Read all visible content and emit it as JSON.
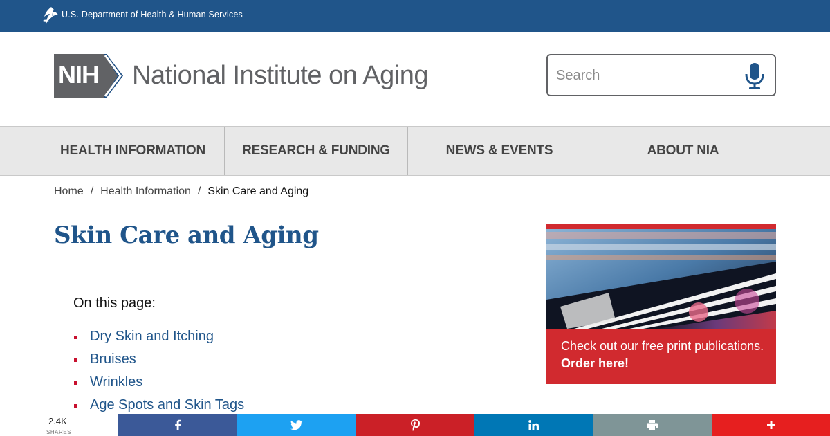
{
  "hhs": {
    "label": "U.S. Department of Health & Human Services"
  },
  "header": {
    "logo_text": "NIH",
    "site_title": "National Institute on Aging",
    "search_placeholder": "Search"
  },
  "nav": {
    "items": [
      {
        "label": "HEALTH INFORMATION"
      },
      {
        "label": "RESEARCH & FUNDING"
      },
      {
        "label": "NEWS & EVENTS"
      },
      {
        "label": "ABOUT NIA"
      }
    ]
  },
  "breadcrumb": {
    "home": "Home",
    "separator": "/",
    "section": "Health Information",
    "current": "Skin Care and Aging"
  },
  "page": {
    "title": "Skin Care and Aging",
    "on_this_page": "On this page:",
    "toc": [
      {
        "label": "Dry Skin and Itching"
      },
      {
        "label": "Bruises"
      },
      {
        "label": "Wrinkles"
      },
      {
        "label": "Age Spots and Skin Tags"
      }
    ]
  },
  "promo": {
    "line1": "Check out our free print publications.",
    "line2": "Order here!"
  },
  "share": {
    "count": "2.4K",
    "count_label": "SHARES",
    "buttons": [
      {
        "icon": "facebook-icon",
        "color": "#3b5998"
      },
      {
        "icon": "twitter-icon",
        "color": "#1da1f2"
      },
      {
        "icon": "pinterest-icon",
        "color": "#cb2027"
      },
      {
        "icon": "linkedin-icon",
        "color": "#0077b5"
      },
      {
        "icon": "print-icon",
        "color": "#7f9597"
      },
      {
        "icon": "plus-icon",
        "color": "#e61f1f"
      }
    ]
  },
  "colors": {
    "hhs_bar": "#20558a",
    "title_blue": "#20558a",
    "nav_bg": "#e8e8e8",
    "accent_red": "#c8102e",
    "logo_gray": "#616265"
  }
}
